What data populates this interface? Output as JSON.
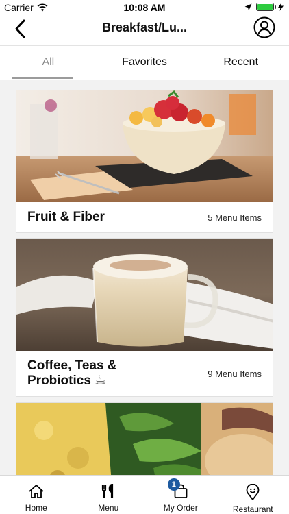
{
  "status_bar": {
    "carrier": "Carrier",
    "time": "10:08 AM",
    "battery_fraction": 1.0
  },
  "header": {
    "title": "Breakfast/Lu...",
    "back_icon": "chevron-left-icon",
    "profile_icon": "user-circle-icon"
  },
  "tabs": [
    {
      "label": "All",
      "active": true
    },
    {
      "label": "Favorites",
      "active": false
    },
    {
      "label": "Recent",
      "active": false
    }
  ],
  "categories": [
    {
      "title": "Fruit & Fiber",
      "count": "5 Menu Items",
      "image": "fruit-bowl"
    },
    {
      "title_line1": "Coffee, Teas &",
      "title_line2": "Probiotics ☕",
      "count": "9 Menu Items",
      "image": "latte"
    },
    {
      "image": "salad-quiche"
    }
  ],
  "tabbar": {
    "items": [
      {
        "label": "Home",
        "icon": "home-icon"
      },
      {
        "label": "Menu",
        "icon": "fork-knife-icon"
      },
      {
        "label": "My Order",
        "icon": "shopping-bag-icon",
        "badge": "1"
      },
      {
        "label": "Restaurant",
        "icon": "restaurant-location-icon"
      }
    ]
  },
  "colors": {
    "accent": "#1e5aa0",
    "battery": "#2ecc40",
    "tab_indicator": "#9b9b9b"
  }
}
